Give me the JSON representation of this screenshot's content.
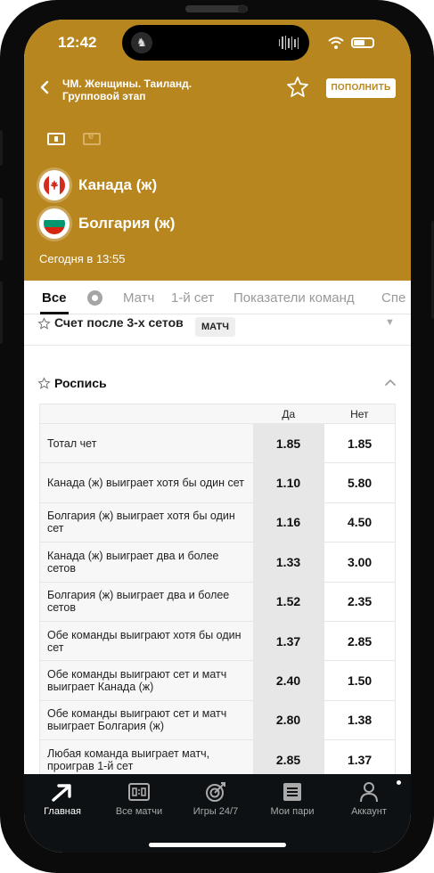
{
  "status": {
    "time": "12:42"
  },
  "header": {
    "tournament_line1": "ЧМ. Женщины. Таиланд.",
    "tournament_line2": "Групповой этап",
    "topup_label": "ПОПОЛНИТЬ",
    "accent_color": "#b8861e"
  },
  "match": {
    "team1": "Канада (ж)",
    "team2": "Болгария (ж)",
    "date": "Сегодня в 13:55"
  },
  "tabs": [
    {
      "label": "Все",
      "active": true
    },
    {
      "label": "Матч"
    },
    {
      "label": "1-й сет"
    },
    {
      "label": "Показатели команд"
    },
    {
      "label": "Спе"
    }
  ],
  "prev_section": {
    "title": "Счет после 3-х сетов",
    "badge": "МАТЧ"
  },
  "section": {
    "title": "Роспись",
    "col_yes": "Да",
    "col_no": "Нет",
    "rows": [
      {
        "label": "Тотал чет",
        "yes": "1.85",
        "no": "1.85"
      },
      {
        "label": "Канада (ж) выиграет хотя бы один сет",
        "yes": "1.10",
        "no": "5.80"
      },
      {
        "label": "Болгария (ж) выиграет хотя бы один сет",
        "yes": "1.16",
        "no": "4.50"
      },
      {
        "label": "Канада (ж) выиграет два и более сетов",
        "yes": "1.33",
        "no": "3.00"
      },
      {
        "label": "Болгария (ж) выиграет два и более сетов",
        "yes": "1.52",
        "no": "2.35"
      },
      {
        "label": "Обе команды выиграют хотя бы один сет",
        "yes": "1.37",
        "no": "2.85"
      },
      {
        "label": "Обе команды выиграют сет и матч выиграет Канада (ж)",
        "yes": "2.40",
        "no": "1.50"
      },
      {
        "label": "Обе команды выиграют сет и матч выиграет Болгария (ж)",
        "yes": "2.80",
        "no": "1.38"
      },
      {
        "label": "Любая команда выиграет матч, проиграв 1-й сет",
        "yes": "2.85",
        "no": "1.37"
      }
    ]
  },
  "nav": [
    {
      "label": "Главная",
      "icon": "arrow-logo-icon",
      "active": true
    },
    {
      "label": "Все матчи",
      "icon": "scoreboard-icon"
    },
    {
      "label": "Игры 24/7",
      "icon": "target-icon"
    },
    {
      "label": "Мои пари",
      "icon": "ticket-icon"
    },
    {
      "label": "Аккаунт",
      "icon": "user-icon"
    }
  ]
}
